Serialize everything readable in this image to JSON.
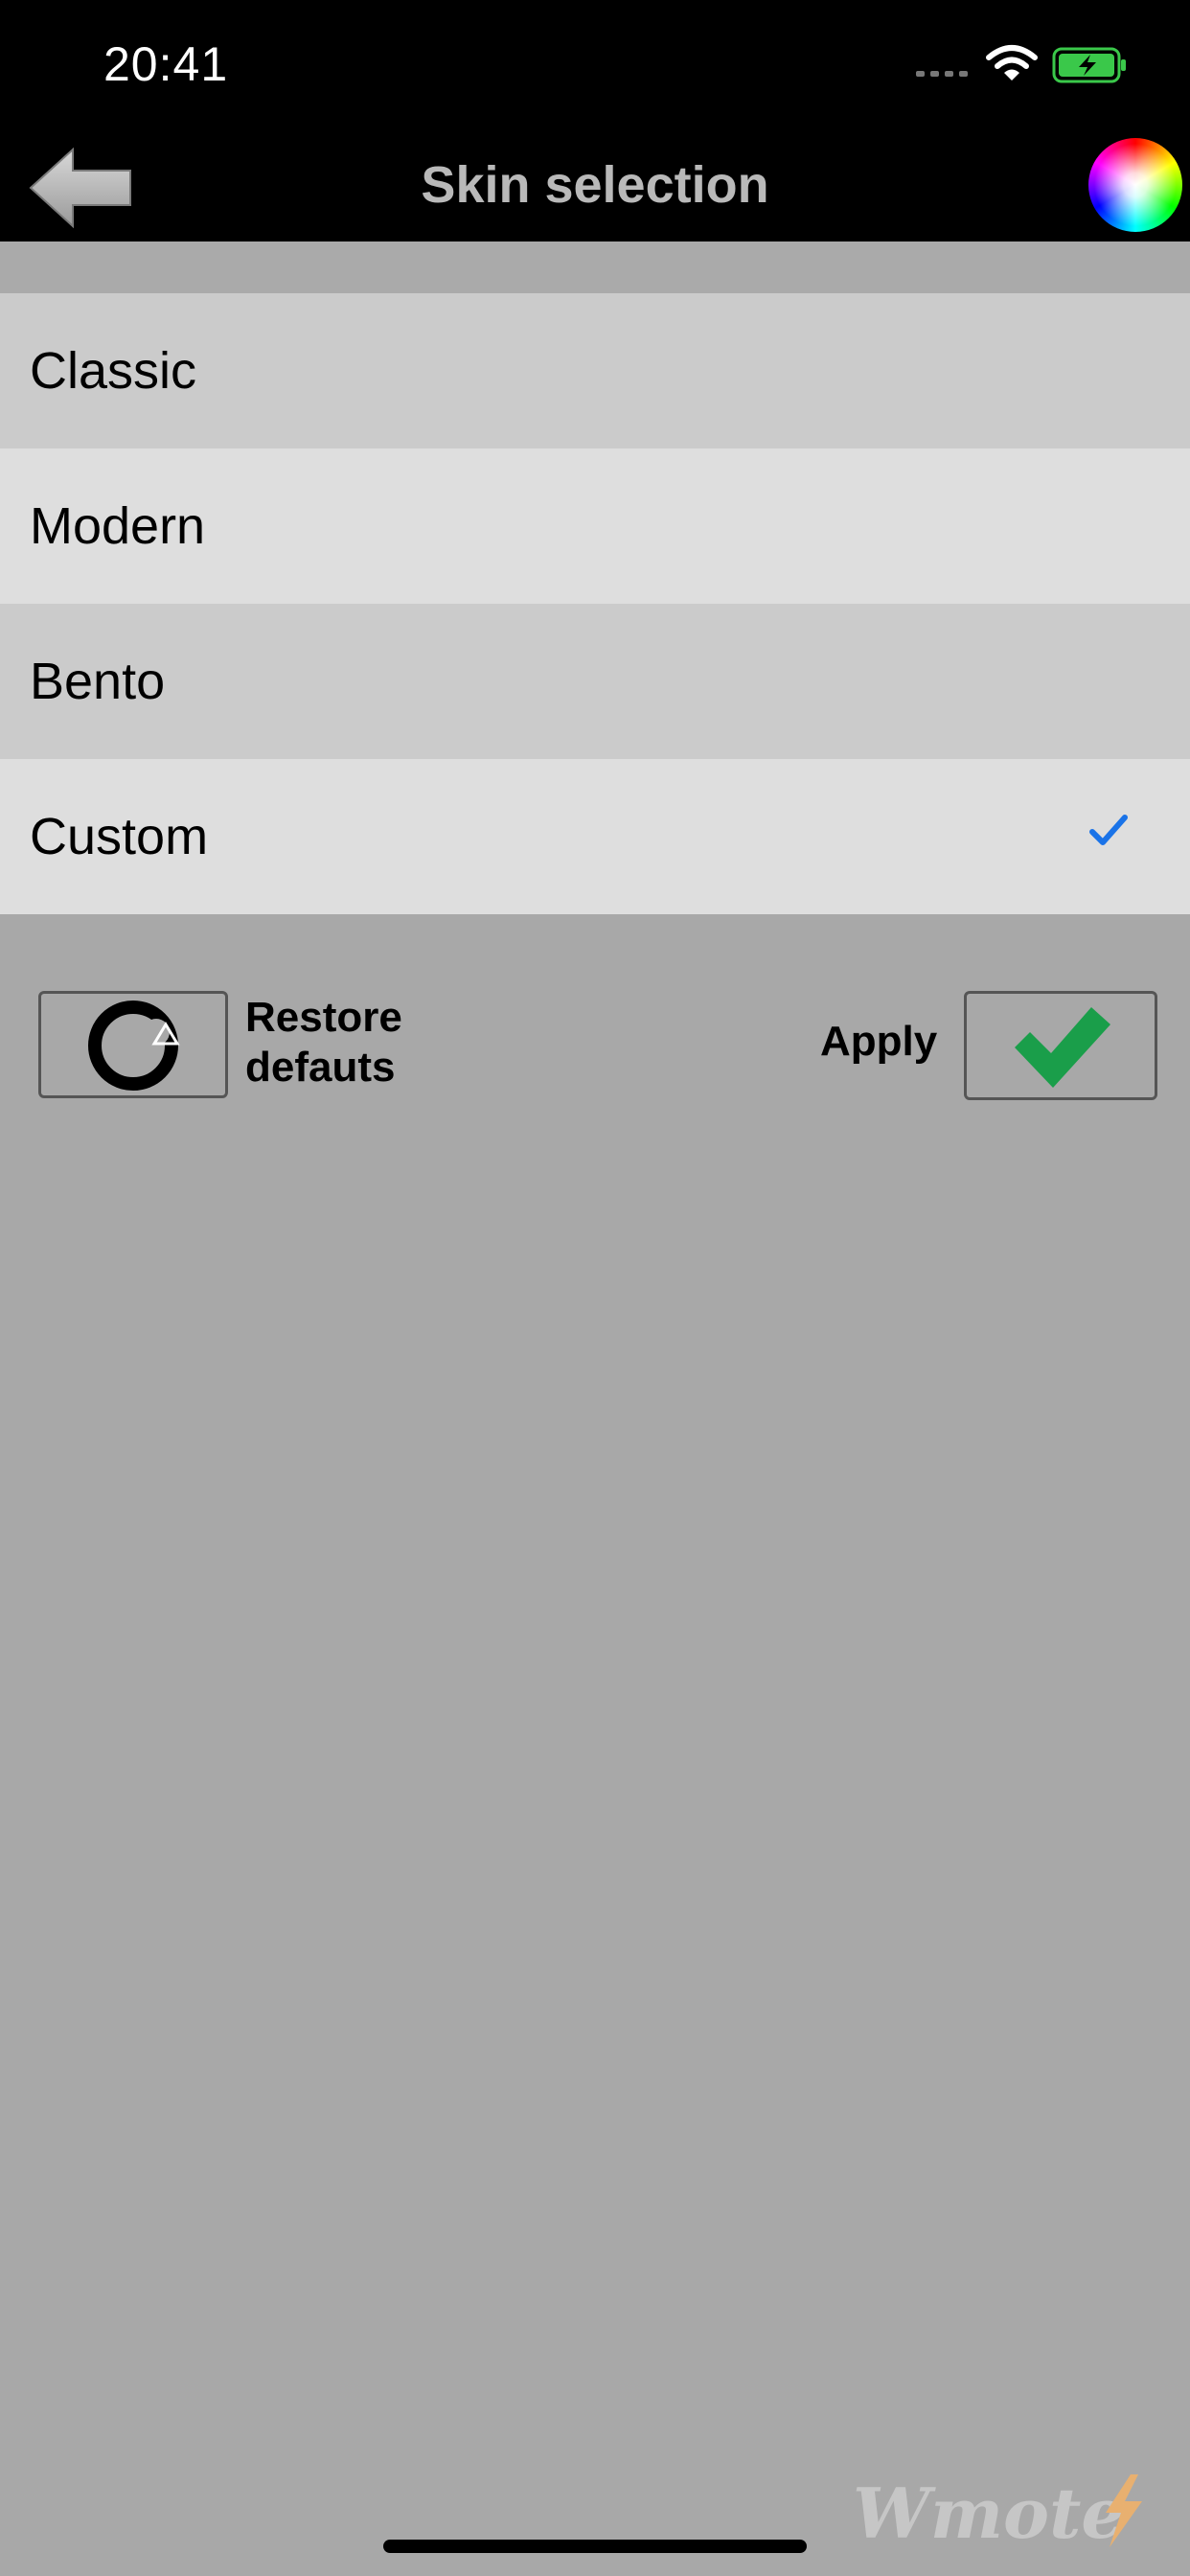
{
  "status_bar": {
    "time": "20:41",
    "icons": [
      "signal-dots-icon",
      "wifi-icon",
      "battery-charging-icon"
    ]
  },
  "nav": {
    "title": "Skin selection",
    "back_icon": "back-arrow-icon",
    "color_icon": "color-wheel-icon"
  },
  "skins": {
    "items": [
      {
        "label": "Classic",
        "selected": false
      },
      {
        "label": "Modern",
        "selected": false
      },
      {
        "label": "Bento",
        "selected": false
      },
      {
        "label": "Custom",
        "selected": true
      }
    ],
    "check_color": "#1a73e8"
  },
  "actions": {
    "restore_label_line1": "Restore",
    "restore_label_line2": "defauts",
    "apply_label": "Apply",
    "apply_check_color": "#1a9e4a"
  },
  "watermark": "Wmote"
}
